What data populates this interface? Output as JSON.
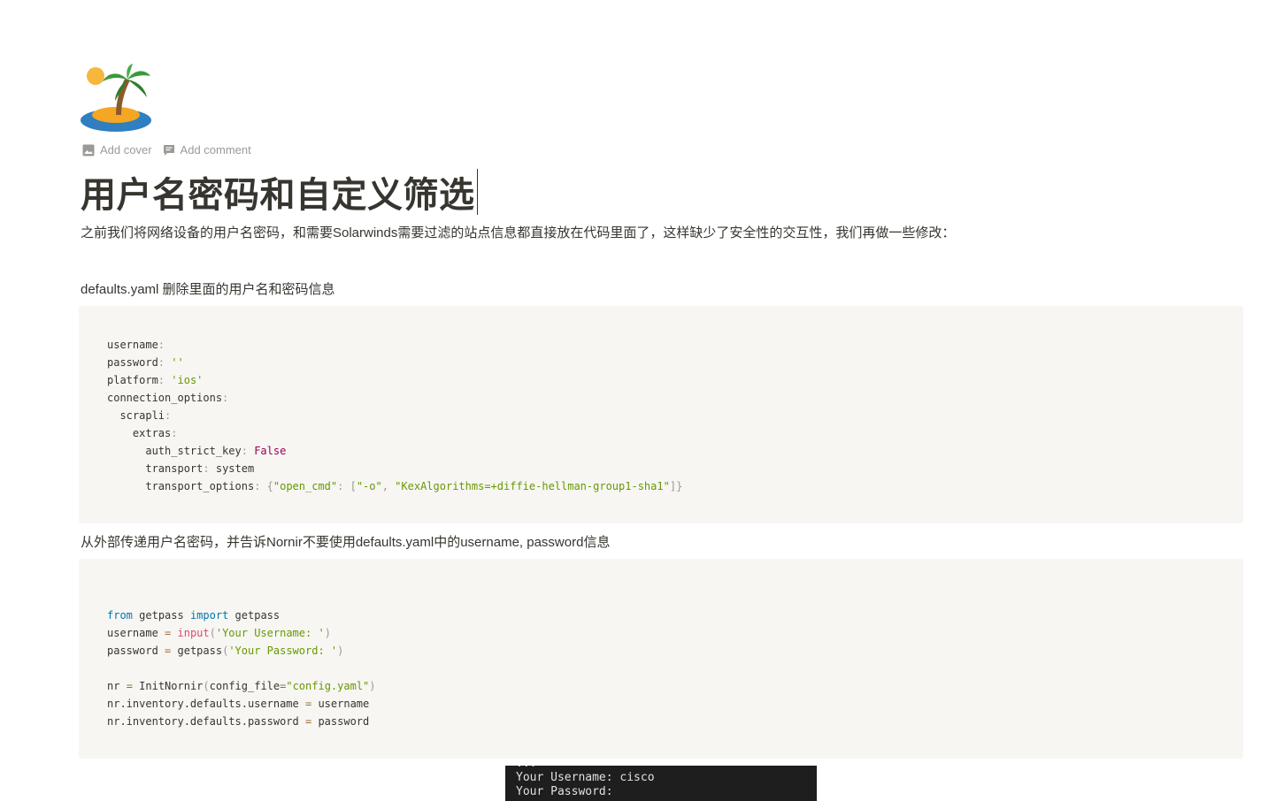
{
  "page": {
    "add_cover": "Add cover",
    "add_comment": "Add comment",
    "title": "用户名密码和自定义筛选",
    "icon": "desert-island-icon"
  },
  "paragraphs": {
    "intro": "之前我们将网络设备的用户名密码，和需要Solarwinds需要过滤的站点信息都直接放在代码里面了，这样缺少了安全性的交互性，我们再做一些修改：",
    "defaults_note": "defaults.yaml  删除里面的用户名和密码信息",
    "external_note": "从外部传递用户名密码，并告诉Nornir不要使用defaults.yaml中的username, password信息"
  },
  "code_yaml": {
    "l1_key": "username",
    "l2_key": "password",
    "l2_val": "''",
    "l3_key": "platform",
    "l3_val": "'ios'",
    "l4_key": "connection_options",
    "l5_key": "scrapli",
    "l6_key": "extras",
    "l7_key": "auth_strict_key",
    "l7_val": "False",
    "l8_key": "transport",
    "l8_val": "system",
    "l9_key": "transport_options",
    "l9_s1": "\"open_cmd\"",
    "l9_s2": "\"-o\"",
    "l9_s3": "\"KexAlgorithms=+diffie-hellman-group1-sha1\""
  },
  "code_python": {
    "l1_kw1": "from",
    "l1_mod": "getpass",
    "l1_kw2": "import",
    "l1_name": "getpass",
    "l2_var": "username",
    "l2_fn": "input",
    "l2_str": "'Your Username: '",
    "l3_var": "password",
    "l3_fn": "getpass",
    "l3_str": "'Your Password: '",
    "l4_var": "nr",
    "l4_fn": "InitNornir",
    "l4_arg": "config_file",
    "l4_str": "\"config.yaml\"",
    "l5_lhs": "nr.inventory.defaults.username",
    "l5_rhs": "username",
    "l6_lhs": "nr.inventory.defaults.password",
    "l6_rhs": "password"
  },
  "terminal": {
    "line0": "...",
    "line1": "Your Username: cisco",
    "line2": "Your Password:"
  }
}
